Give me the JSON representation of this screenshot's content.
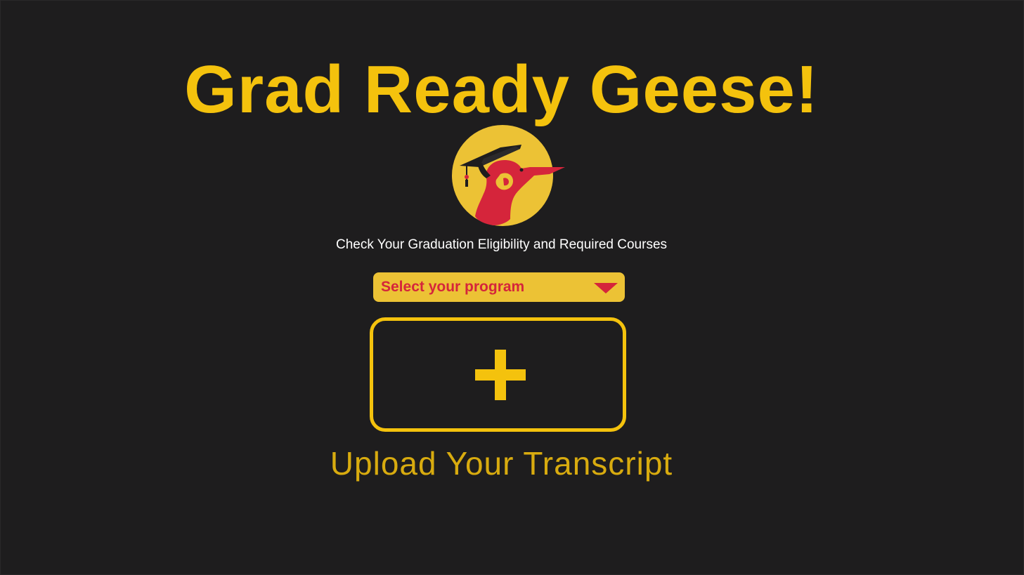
{
  "app": {
    "title": "Grad Ready Geese!",
    "subtitle": "Check Your Graduation Eligibility and Required Courses",
    "logo_icon": "graduation-goose-logo"
  },
  "program_select": {
    "label": "Select your program",
    "icon": "chevron-down-icon"
  },
  "upload": {
    "icon": "plus-icon",
    "caption": "Upload Your Transcript"
  },
  "colors": {
    "background": "#1e1d1e",
    "accent_yellow": "#f4c20d",
    "select_yellow": "#ecc235",
    "accent_red": "#d5253b",
    "text_white": "#ffffff"
  }
}
